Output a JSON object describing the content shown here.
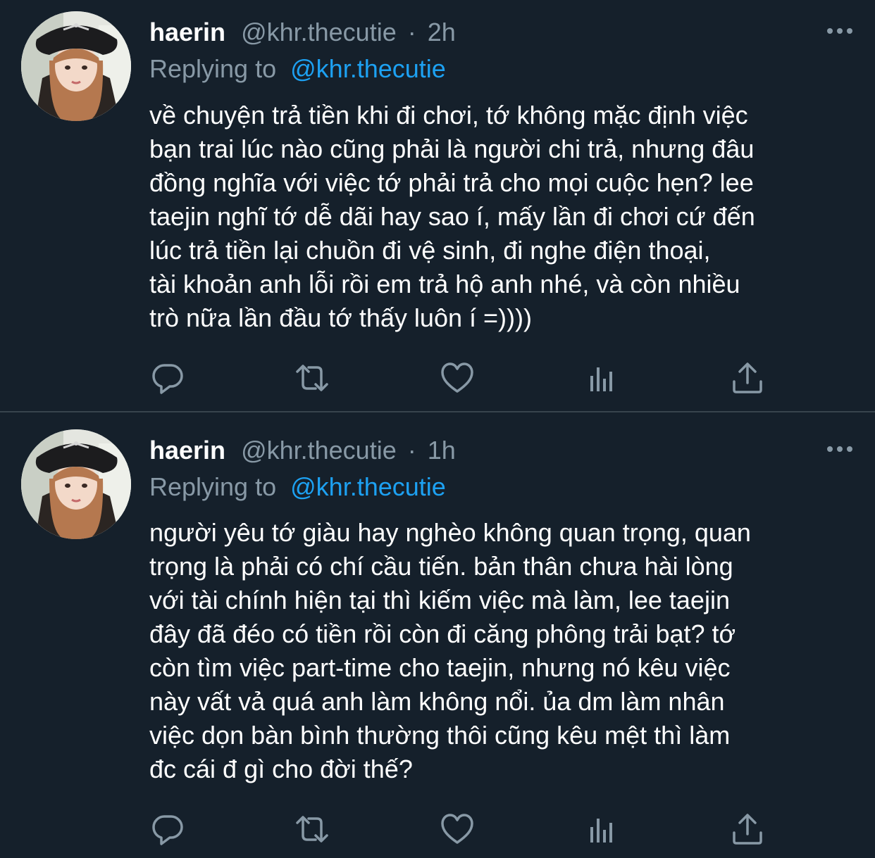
{
  "colors": {
    "background": "#15202b",
    "text": "#ffffff",
    "muted": "#8899a6",
    "link": "#1da1f2",
    "divider": "#38444d"
  },
  "tweets": [
    {
      "name": "haerin",
      "handle": "@khr.thecutie",
      "separator": "·",
      "time": "2h",
      "reply_label": "Replying to",
      "reply_handle": "@khr.thecutie",
      "text": "về chuyện trả tiền khi đi chơi, tớ không mặc định việc\nbạn trai lúc nào cũng phải là người chi trả, nhưng đâu\nđồng nghĩa với việc tớ phải trả cho mọi cuộc hẹn? lee\ntaejin nghĩ tớ dễ dãi hay sao í, mấy lần đi chơi cứ đến\nlúc trả tiền lại chuồn đi vệ sinh, đi nghe điện thoại,\ntài khoản anh lỗi rồi em trả hộ anh nhé, và còn nhiều\ntrò nữa lần đầu tớ thấy luôn í =))))",
      "icons": [
        "reply-icon",
        "retweet-icon",
        "like-icon",
        "analytics-icon",
        "share-icon"
      ],
      "more_icon": "more-icon"
    },
    {
      "name": "haerin",
      "handle": "@khr.thecutie",
      "separator": "·",
      "time": "1h",
      "reply_label": "Replying to",
      "reply_handle": "@khr.thecutie",
      "text": "người yêu tớ giàu hay nghèo không quan trọng, quan\ntrọng là phải có chí cầu tiến. bản thân chưa hài lòng\nvới tài chính hiện tại thì kiếm việc mà làm, lee taejin\nđây đã đéo có tiền rồi còn đi căng phông trải bạt? tớ\ncòn tìm việc part-time cho taejin, nhưng nó kêu việc\nnày vất vả quá anh làm không nổi. ủa dm làm nhân\nviệc dọn bàn bình thường thôi cũng kêu mệt thì làm\nđc cái đ gì cho đời thế?",
      "icons": [
        "reply-icon",
        "retweet-icon",
        "like-icon",
        "analytics-icon",
        "share-icon"
      ],
      "more_icon": "more-icon"
    }
  ]
}
